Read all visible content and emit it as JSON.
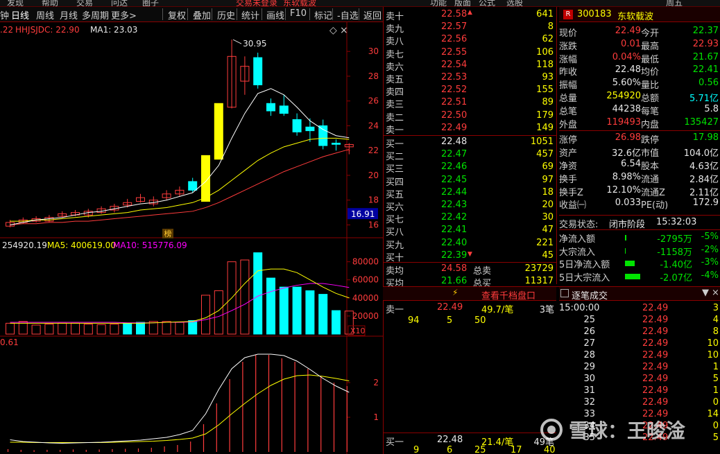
{
  "topbar": {
    "items": [
      "发现",
      "帮助",
      "交易",
      "问达",
      "圈子",
      "交易未登录",
      "东软载波",
      "功能",
      "版面",
      "公式",
      "选股",
      "周五"
    ]
  },
  "toolbar": {
    "items": [
      {
        "label": "钟",
        "active": false
      },
      {
        "label": "日线",
        "active": true
      },
      {
        "label": "周线",
        "active": false
      },
      {
        "label": "月线",
        "active": false
      },
      {
        "label": "多周期",
        "active": false
      },
      {
        "label": "更多>",
        "active": false
      },
      {
        "label": "复权",
        "active": false
      },
      {
        "label": "叠加",
        "active": false
      },
      {
        "label": "历史",
        "active": false
      },
      {
        "label": "统计",
        "active": false
      },
      {
        "label": "画线",
        "active": false
      },
      {
        "label": "F10",
        "active": false
      },
      {
        "label": "标记",
        "active": false
      },
      {
        "label": "-自选",
        "active": false
      },
      {
        "label": "返回",
        "active": false
      }
    ]
  },
  "colors": {
    "up": "#ff3c3c",
    "down": "#00ffff",
    "ma5": "#ffffff",
    "ma10": "#ffff00",
    "ma20": "#ff00ff",
    "ma60": "#ff3c3c",
    "grid": "#8b0000",
    "bg": "#000000"
  },
  "price_legend": {
    "prefix": ".22",
    "hhjsjdc": "HHJSJDC: 22.90",
    "ma1": "MA1: 23.03"
  },
  "price_annotations": {
    "high_label": "30.95",
    "current_price_tag": "16.91",
    "rank_badge": "榜"
  },
  "volume_legend": {
    "vol": "254920.19",
    "ma5": "MA5: 400619.00",
    "ma10": "MA10: 515776.09",
    "multiplier": "X10"
  },
  "macd_legend": {
    "value": "0.61"
  },
  "chart_data": [
    {
      "type": "candlestick",
      "title": "",
      "ylim": [
        15.3,
        31.8
      ],
      "yticks": [
        16.0,
        18.0,
        20.0,
        22.0,
        24.0,
        26.0,
        28.0,
        30.0
      ],
      "candles": [
        [
          15.9,
          16.2,
          16.4,
          15.8
        ],
        [
          16.2,
          16.4,
          16.6,
          16.1
        ],
        [
          16.3,
          16.5,
          16.7,
          16.2
        ],
        [
          16.3,
          16.6,
          16.8,
          16.2
        ],
        [
          16.7,
          16.9,
          17.1,
          16.6
        ],
        [
          16.8,
          17.0,
          17.2,
          16.7
        ],
        [
          16.8,
          17.1,
          17.3,
          16.6
        ],
        [
          17.0,
          17.3,
          17.5,
          16.9
        ],
        [
          17.2,
          17.5,
          17.7,
          17.0
        ],
        [
          17.6,
          17.8,
          18.1,
          17.4
        ],
        [
          17.9,
          18.2,
          18.5,
          17.8
        ],
        [
          17.7,
          18.0,
          18.3,
          17.5
        ],
        [
          18.2,
          18.5,
          18.8,
          18.0
        ],
        [
          18.5,
          18.8,
          19.1,
          18.3
        ],
        [
          19.5,
          18.8,
          19.8,
          18.6
        ],
        [
          17.9,
          21.6,
          21.6,
          17.9
        ],
        [
          21.3,
          25.8,
          25.8,
          21.3
        ],
        [
          25.5,
          29.6,
          30.95,
          25.4
        ],
        [
          27.6,
          28.8,
          29.6,
          26.5
        ],
        [
          29.5,
          27.3,
          29.9,
          27.0
        ],
        [
          25.8,
          25.2,
          26.2,
          24.8
        ],
        [
          25.6,
          25.0,
          26.5,
          24.8
        ],
        [
          24.5,
          23.5,
          25.0,
          23.2
        ],
        [
          23.9,
          23.6,
          24.6,
          22.7
        ],
        [
          24.0,
          22.4,
          24.5,
          22.1
        ],
        [
          22.6,
          22.5,
          22.9,
          22.0
        ],
        [
          22.3,
          22.49,
          22.6,
          21.7
        ]
      ],
      "ma5": [
        16.0,
        16.2,
        16.4,
        16.5,
        16.6,
        16.8,
        17.0,
        17.1,
        17.3,
        17.5,
        17.7,
        17.8,
        18.0,
        18.3,
        18.6,
        19.5,
        20.8,
        23.0,
        25.0,
        26.6,
        27.0,
        26.5,
        25.5,
        24.4,
        23.7,
        23.2,
        23.03
      ],
      "ma10": [
        16.3,
        16.3,
        16.4,
        16.4,
        16.5,
        16.6,
        16.7,
        16.8,
        16.9,
        17.0,
        17.2,
        17.3,
        17.4,
        17.6,
        17.8,
        18.2,
        18.8,
        19.6,
        20.4,
        21.2,
        21.8,
        22.3,
        22.6,
        22.9,
        23.0,
        23.0,
        22.9
      ],
      "ma60": [
        16.0,
        16.1,
        16.1,
        16.2,
        16.2,
        16.3,
        16.3,
        16.4,
        16.5,
        16.6,
        16.7,
        16.8,
        16.9,
        17.0,
        17.1,
        17.4,
        17.8,
        18.3,
        18.8,
        19.3,
        19.8,
        20.3,
        20.7,
        21.1,
        21.5,
        21.8,
        22.1
      ]
    },
    {
      "type": "bar",
      "title": "",
      "ylim": [
        0,
        92000
      ],
      "yticks": [
        20000,
        40000,
        60000,
        80000
      ],
      "values": [
        12000,
        14000,
        10000,
        11000,
        12000,
        12000,
        11000,
        10500,
        11000,
        12000,
        13000,
        14000,
        14000,
        13000,
        15000,
        43000,
        48000,
        80000,
        82000,
        90000,
        62000,
        52000,
        52000,
        48000,
        44000,
        26000,
        25500
      ],
      "up": [
        1,
        1,
        1,
        1,
        1,
        1,
        1,
        1,
        1,
        0,
        0,
        1,
        1,
        1,
        0,
        1,
        1,
        1,
        1,
        0,
        0,
        0,
        0,
        0,
        0,
        0,
        1
      ],
      "ma5": [
        12000,
        12000,
        12000,
        12000,
        12000,
        12000,
        12000,
        12000,
        12000,
        12000,
        12000,
        12500,
        13000,
        13500,
        14000,
        18000,
        26000,
        40000,
        56000,
        70000,
        72000,
        72000,
        68000,
        60000,
        52000,
        45000,
        40062
      ],
      "ma10": [
        13000,
        13000,
        13000,
        13000,
        13000,
        13000,
        13000,
        13000,
        13000,
        12500,
        12500,
        12500,
        13000,
        13000,
        13500,
        16000,
        19500,
        26000,
        33000,
        42000,
        47000,
        51000,
        54000,
        56000,
        56000,
        54000,
        51578
      ]
    },
    {
      "type": "bar",
      "title": "",
      "ylim": [
        0,
        3.0
      ],
      "yticks": [
        1.0,
        2.0
      ],
      "values": [
        0.08,
        0.06,
        0.05,
        0.06,
        0.06,
        0.07,
        0.06,
        0.07,
        0.08,
        0.09,
        0.1,
        0.12,
        0.16,
        0.2,
        0.3,
        0.8,
        1.4,
        2.1,
        2.6,
        2.8,
        2.8,
        2.7,
        2.6,
        2.4,
        2.2,
        2.0,
        1.9
      ],
      "dif": [
        0.35,
        0.3,
        0.28,
        0.26,
        0.25,
        0.26,
        0.27,
        0.28,
        0.3,
        0.32,
        0.34,
        0.38,
        0.42,
        0.5,
        0.62,
        1.1,
        1.8,
        2.4,
        2.72,
        2.82,
        2.82,
        2.78,
        2.62,
        2.38,
        2.12,
        1.9,
        1.72
      ],
      "dea": [
        0.28,
        0.28,
        0.27,
        0.27,
        0.27,
        0.27,
        0.27,
        0.27,
        0.28,
        0.29,
        0.3,
        0.31,
        0.33,
        0.36,
        0.4,
        0.52,
        0.78,
        1.1,
        1.4,
        1.68,
        1.92,
        2.1,
        2.2,
        2.22,
        2.18,
        2.12,
        2.05
      ]
    }
  ],
  "order_book": {
    "asks": [
      {
        "label": "卖十",
        "price": "22.58",
        "vol": "641"
      },
      {
        "label": "卖九",
        "price": "22.57",
        "vol": "8"
      },
      {
        "label": "卖八",
        "price": "22.56",
        "vol": "62"
      },
      {
        "label": "卖七",
        "price": "22.55",
        "vol": "106"
      },
      {
        "label": "卖六",
        "price": "22.54",
        "vol": "118"
      },
      {
        "label": "卖五",
        "price": "22.53",
        "vol": "93"
      },
      {
        "label": "卖四",
        "price": "22.52",
        "vol": "155"
      },
      {
        "label": "卖三",
        "price": "22.51",
        "vol": "89"
      },
      {
        "label": "卖二",
        "price": "22.50",
        "vol": "179"
      },
      {
        "label": "卖一",
        "price": "22.49",
        "vol": "149"
      }
    ],
    "bids": [
      {
        "label": "买一",
        "price": "22.48",
        "vol": "1051"
      },
      {
        "label": "买二",
        "price": "22.47",
        "vol": "457"
      },
      {
        "label": "买三",
        "price": "22.46",
        "vol": "69"
      },
      {
        "label": "买四",
        "price": "22.45",
        "vol": "97"
      },
      {
        "label": "买五",
        "price": "22.44",
        "vol": "18"
      },
      {
        "label": "买六",
        "price": "22.43",
        "vol": "20"
      },
      {
        "label": "买七",
        "price": "22.42",
        "vol": "30"
      },
      {
        "label": "买八",
        "price": "22.41",
        "vol": "47"
      },
      {
        "label": "买九",
        "price": "22.40",
        "vol": "221"
      },
      {
        "label": "买十",
        "price": "22.39",
        "vol": "45"
      }
    ],
    "summary": [
      {
        "l1": "卖均",
        "v1": "24.58",
        "l2": "总卖",
        "v2": "23729"
      },
      {
        "l1": "买均",
        "v1": "21.66",
        "l2": "总买",
        "v2": "11317"
      }
    ]
  },
  "stock_info": {
    "badge": "R",
    "code": "300183",
    "name": "东软载波",
    "rows": [
      {
        "l1": "现价",
        "v1": "22.49",
        "c1": "red",
        "l2": "今开",
        "v2": "22.37",
        "c2": "green"
      },
      {
        "l1": "涨跌",
        "v1": "0.01",
        "c1": "red",
        "l2": "最高",
        "v2": "22.93",
        "c2": "red"
      },
      {
        "l1": "涨幅",
        "v1": "0.04%",
        "c1": "red",
        "l2": "最低",
        "v2": "21.67",
        "c2": "green"
      },
      {
        "l1": "昨收",
        "v1": "22.48",
        "c1": "white",
        "l2": "均价",
        "v2": "22.41",
        "c2": "green"
      },
      {
        "l1": "振幅",
        "v1": "5.60%",
        "c1": "white",
        "l2": "量比",
        "v2": "0.56",
        "c2": "green"
      },
      {
        "l1": "总量",
        "v1": "254920",
        "c1": "yellow",
        "l2": "总额",
        "v2": "5.71亿",
        "c2": "cyan"
      },
      {
        "l1": "总笔",
        "v1": "44238",
        "c1": "white",
        "l2": "每笔",
        "v2": "5.8",
        "c2": "white"
      },
      {
        "l1": "外盘",
        "v1": "119493",
        "c1": "red",
        "l2": "内盘",
        "v2": "135427",
        "c2": "green"
      },
      {
        "l1": "涨停",
        "v1": "26.98",
        "c1": "red",
        "l2": "跌停",
        "v2": "17.98",
        "c2": "green"
      },
      {
        "l1": "资产",
        "v1": "32.6亿",
        "c1": "white",
        "l2": "市值",
        "v2": "104.0亿",
        "c2": "white"
      },
      {
        "l1": "净资",
        "v1": "6.54",
        "c1": "white",
        "l2": "股本",
        "v2": "4.63亿",
        "c2": "white"
      },
      {
        "l1": "换手",
        "v1": "8.98%",
        "c1": "white",
        "l2": "流通",
        "v2": "2.84亿",
        "c2": "white"
      },
      {
        "l1": "换手Z",
        "v1": "12.10%",
        "c1": "white",
        "l2": "流通Z",
        "v2": "2.11亿",
        "c2": "white"
      },
      {
        "l1": "收益㈠",
        "v1": "0.033",
        "c1": "white",
        "l2": "PE(动)",
        "v2": "172.9",
        "c2": "white"
      }
    ],
    "status_label": "交易状态:",
    "status_value": "闭市阶段",
    "status_time": "15:32:03"
  },
  "fund_flow": [
    {
      "label": "净流入额",
      "value": "-2795万",
      "pct": "-5%"
    },
    {
      "label": "大宗流入",
      "value": "-1158万",
      "pct": "-2%"
    },
    {
      "label": "5日净流入额",
      "value": "-1.40亿",
      "pct": "-3%"
    },
    {
      "label": "5日大宗流入",
      "value": "-2.07亿",
      "pct": "-4%"
    }
  ],
  "queue_panel": {
    "link": "查看千档盘口",
    "sell": {
      "label": "卖一",
      "price": "22.49",
      "vol": "49.7/笔",
      "count": "3笔",
      "orders": [
        "94",
        "5",
        "50"
      ]
    },
    "buy": {
      "label": "买一",
      "price": "22.48",
      "vol": "21.4/笔",
      "count": "49笔",
      "orders": [
        "9",
        "6",
        "25",
        "17",
        "40"
      ]
    }
  },
  "ticks": {
    "title": "逐笔成交",
    "rows": [
      {
        "time": "15:00:00",
        "price": "22.49",
        "vol": "3"
      },
      {
        "time": "25",
        "price": "22.49",
        "vol": "4"
      },
      {
        "time": "26",
        "price": "22.49",
        "vol": "8"
      },
      {
        "time": "27",
        "price": "22.49",
        "vol": "10"
      },
      {
        "time": "28",
        "price": "22.49",
        "vol": "10"
      },
      {
        "time": "29",
        "price": "22.49",
        "vol": "1"
      },
      {
        "time": "30",
        "price": "22.49",
        "vol": "5"
      },
      {
        "time": "31",
        "price": "22.49",
        "vol": "1"
      },
      {
        "time": "32",
        "price": "22.49",
        "vol": "0"
      },
      {
        "time": "33",
        "price": "22.49",
        "vol": "14"
      },
      {
        "time": "34",
        "price": "22.49",
        "vol": "0"
      },
      {
        "time": "35",
        "price": "22.49",
        "vol": "5"
      }
    ]
  },
  "watermark": "雪球：王晙淦"
}
